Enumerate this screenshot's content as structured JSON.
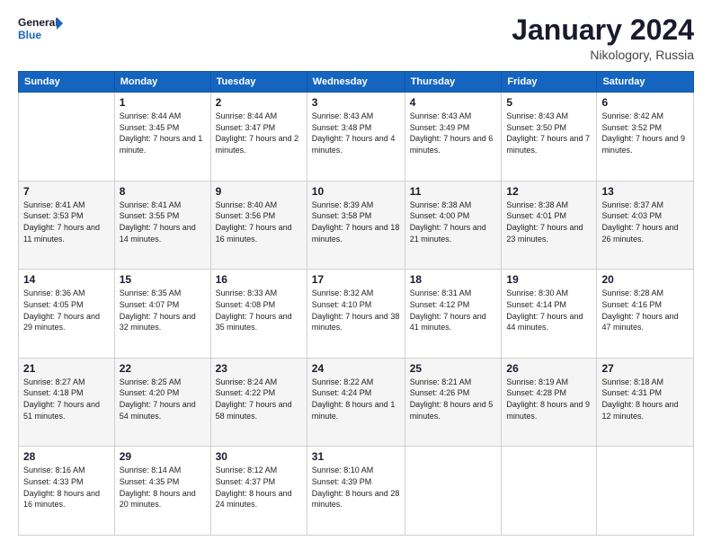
{
  "header": {
    "logo_line1": "General",
    "logo_line2": "Blue",
    "title": "January 2024",
    "subtitle": "Nikologory, Russia"
  },
  "columns": [
    "Sunday",
    "Monday",
    "Tuesday",
    "Wednesday",
    "Thursday",
    "Friday",
    "Saturday"
  ],
  "weeks": [
    [
      {
        "day": "",
        "sunrise": "",
        "sunset": "",
        "daylight": ""
      },
      {
        "day": "1",
        "sunrise": "Sunrise: 8:44 AM",
        "sunset": "Sunset: 3:45 PM",
        "daylight": "Daylight: 7 hours and 1 minute."
      },
      {
        "day": "2",
        "sunrise": "Sunrise: 8:44 AM",
        "sunset": "Sunset: 3:47 PM",
        "daylight": "Daylight: 7 hours and 2 minutes."
      },
      {
        "day": "3",
        "sunrise": "Sunrise: 8:43 AM",
        "sunset": "Sunset: 3:48 PM",
        "daylight": "Daylight: 7 hours and 4 minutes."
      },
      {
        "day": "4",
        "sunrise": "Sunrise: 8:43 AM",
        "sunset": "Sunset: 3:49 PM",
        "daylight": "Daylight: 7 hours and 6 minutes."
      },
      {
        "day": "5",
        "sunrise": "Sunrise: 8:43 AM",
        "sunset": "Sunset: 3:50 PM",
        "daylight": "Daylight: 7 hours and 7 minutes."
      },
      {
        "day": "6",
        "sunrise": "Sunrise: 8:42 AM",
        "sunset": "Sunset: 3:52 PM",
        "daylight": "Daylight: 7 hours and 9 minutes."
      }
    ],
    [
      {
        "day": "7",
        "sunrise": "Sunrise: 8:41 AM",
        "sunset": "Sunset: 3:53 PM",
        "daylight": "Daylight: 7 hours and 11 minutes."
      },
      {
        "day": "8",
        "sunrise": "Sunrise: 8:41 AM",
        "sunset": "Sunset: 3:55 PM",
        "daylight": "Daylight: 7 hours and 14 minutes."
      },
      {
        "day": "9",
        "sunrise": "Sunrise: 8:40 AM",
        "sunset": "Sunset: 3:56 PM",
        "daylight": "Daylight: 7 hours and 16 minutes."
      },
      {
        "day": "10",
        "sunrise": "Sunrise: 8:39 AM",
        "sunset": "Sunset: 3:58 PM",
        "daylight": "Daylight: 7 hours and 18 minutes."
      },
      {
        "day": "11",
        "sunrise": "Sunrise: 8:38 AM",
        "sunset": "Sunset: 4:00 PM",
        "daylight": "Daylight: 7 hours and 21 minutes."
      },
      {
        "day": "12",
        "sunrise": "Sunrise: 8:38 AM",
        "sunset": "Sunset: 4:01 PM",
        "daylight": "Daylight: 7 hours and 23 minutes."
      },
      {
        "day": "13",
        "sunrise": "Sunrise: 8:37 AM",
        "sunset": "Sunset: 4:03 PM",
        "daylight": "Daylight: 7 hours and 26 minutes."
      }
    ],
    [
      {
        "day": "14",
        "sunrise": "Sunrise: 8:36 AM",
        "sunset": "Sunset: 4:05 PM",
        "daylight": "Daylight: 7 hours and 29 minutes."
      },
      {
        "day": "15",
        "sunrise": "Sunrise: 8:35 AM",
        "sunset": "Sunset: 4:07 PM",
        "daylight": "Daylight: 7 hours and 32 minutes."
      },
      {
        "day": "16",
        "sunrise": "Sunrise: 8:33 AM",
        "sunset": "Sunset: 4:08 PM",
        "daylight": "Daylight: 7 hours and 35 minutes."
      },
      {
        "day": "17",
        "sunrise": "Sunrise: 8:32 AM",
        "sunset": "Sunset: 4:10 PM",
        "daylight": "Daylight: 7 hours and 38 minutes."
      },
      {
        "day": "18",
        "sunrise": "Sunrise: 8:31 AM",
        "sunset": "Sunset: 4:12 PM",
        "daylight": "Daylight: 7 hours and 41 minutes."
      },
      {
        "day": "19",
        "sunrise": "Sunrise: 8:30 AM",
        "sunset": "Sunset: 4:14 PM",
        "daylight": "Daylight: 7 hours and 44 minutes."
      },
      {
        "day": "20",
        "sunrise": "Sunrise: 8:28 AM",
        "sunset": "Sunset: 4:16 PM",
        "daylight": "Daylight: 7 hours and 47 minutes."
      }
    ],
    [
      {
        "day": "21",
        "sunrise": "Sunrise: 8:27 AM",
        "sunset": "Sunset: 4:18 PM",
        "daylight": "Daylight: 7 hours and 51 minutes."
      },
      {
        "day": "22",
        "sunrise": "Sunrise: 8:25 AM",
        "sunset": "Sunset: 4:20 PM",
        "daylight": "Daylight: 7 hours and 54 minutes."
      },
      {
        "day": "23",
        "sunrise": "Sunrise: 8:24 AM",
        "sunset": "Sunset: 4:22 PM",
        "daylight": "Daylight: 7 hours and 58 minutes."
      },
      {
        "day": "24",
        "sunrise": "Sunrise: 8:22 AM",
        "sunset": "Sunset: 4:24 PM",
        "daylight": "Daylight: 8 hours and 1 minute."
      },
      {
        "day": "25",
        "sunrise": "Sunrise: 8:21 AM",
        "sunset": "Sunset: 4:26 PM",
        "daylight": "Daylight: 8 hours and 5 minutes."
      },
      {
        "day": "26",
        "sunrise": "Sunrise: 8:19 AM",
        "sunset": "Sunset: 4:28 PM",
        "daylight": "Daylight: 8 hours and 9 minutes."
      },
      {
        "day": "27",
        "sunrise": "Sunrise: 8:18 AM",
        "sunset": "Sunset: 4:31 PM",
        "daylight": "Daylight: 8 hours and 12 minutes."
      }
    ],
    [
      {
        "day": "28",
        "sunrise": "Sunrise: 8:16 AM",
        "sunset": "Sunset: 4:33 PM",
        "daylight": "Daylight: 8 hours and 16 minutes."
      },
      {
        "day": "29",
        "sunrise": "Sunrise: 8:14 AM",
        "sunset": "Sunset: 4:35 PM",
        "daylight": "Daylight: 8 hours and 20 minutes."
      },
      {
        "day": "30",
        "sunrise": "Sunrise: 8:12 AM",
        "sunset": "Sunset: 4:37 PM",
        "daylight": "Daylight: 8 hours and 24 minutes."
      },
      {
        "day": "31",
        "sunrise": "Sunrise: 8:10 AM",
        "sunset": "Sunset: 4:39 PM",
        "daylight": "Daylight: 8 hours and 28 minutes."
      },
      {
        "day": "",
        "sunrise": "",
        "sunset": "",
        "daylight": ""
      },
      {
        "day": "",
        "sunrise": "",
        "sunset": "",
        "daylight": ""
      },
      {
        "day": "",
        "sunrise": "",
        "sunset": "",
        "daylight": ""
      }
    ]
  ]
}
